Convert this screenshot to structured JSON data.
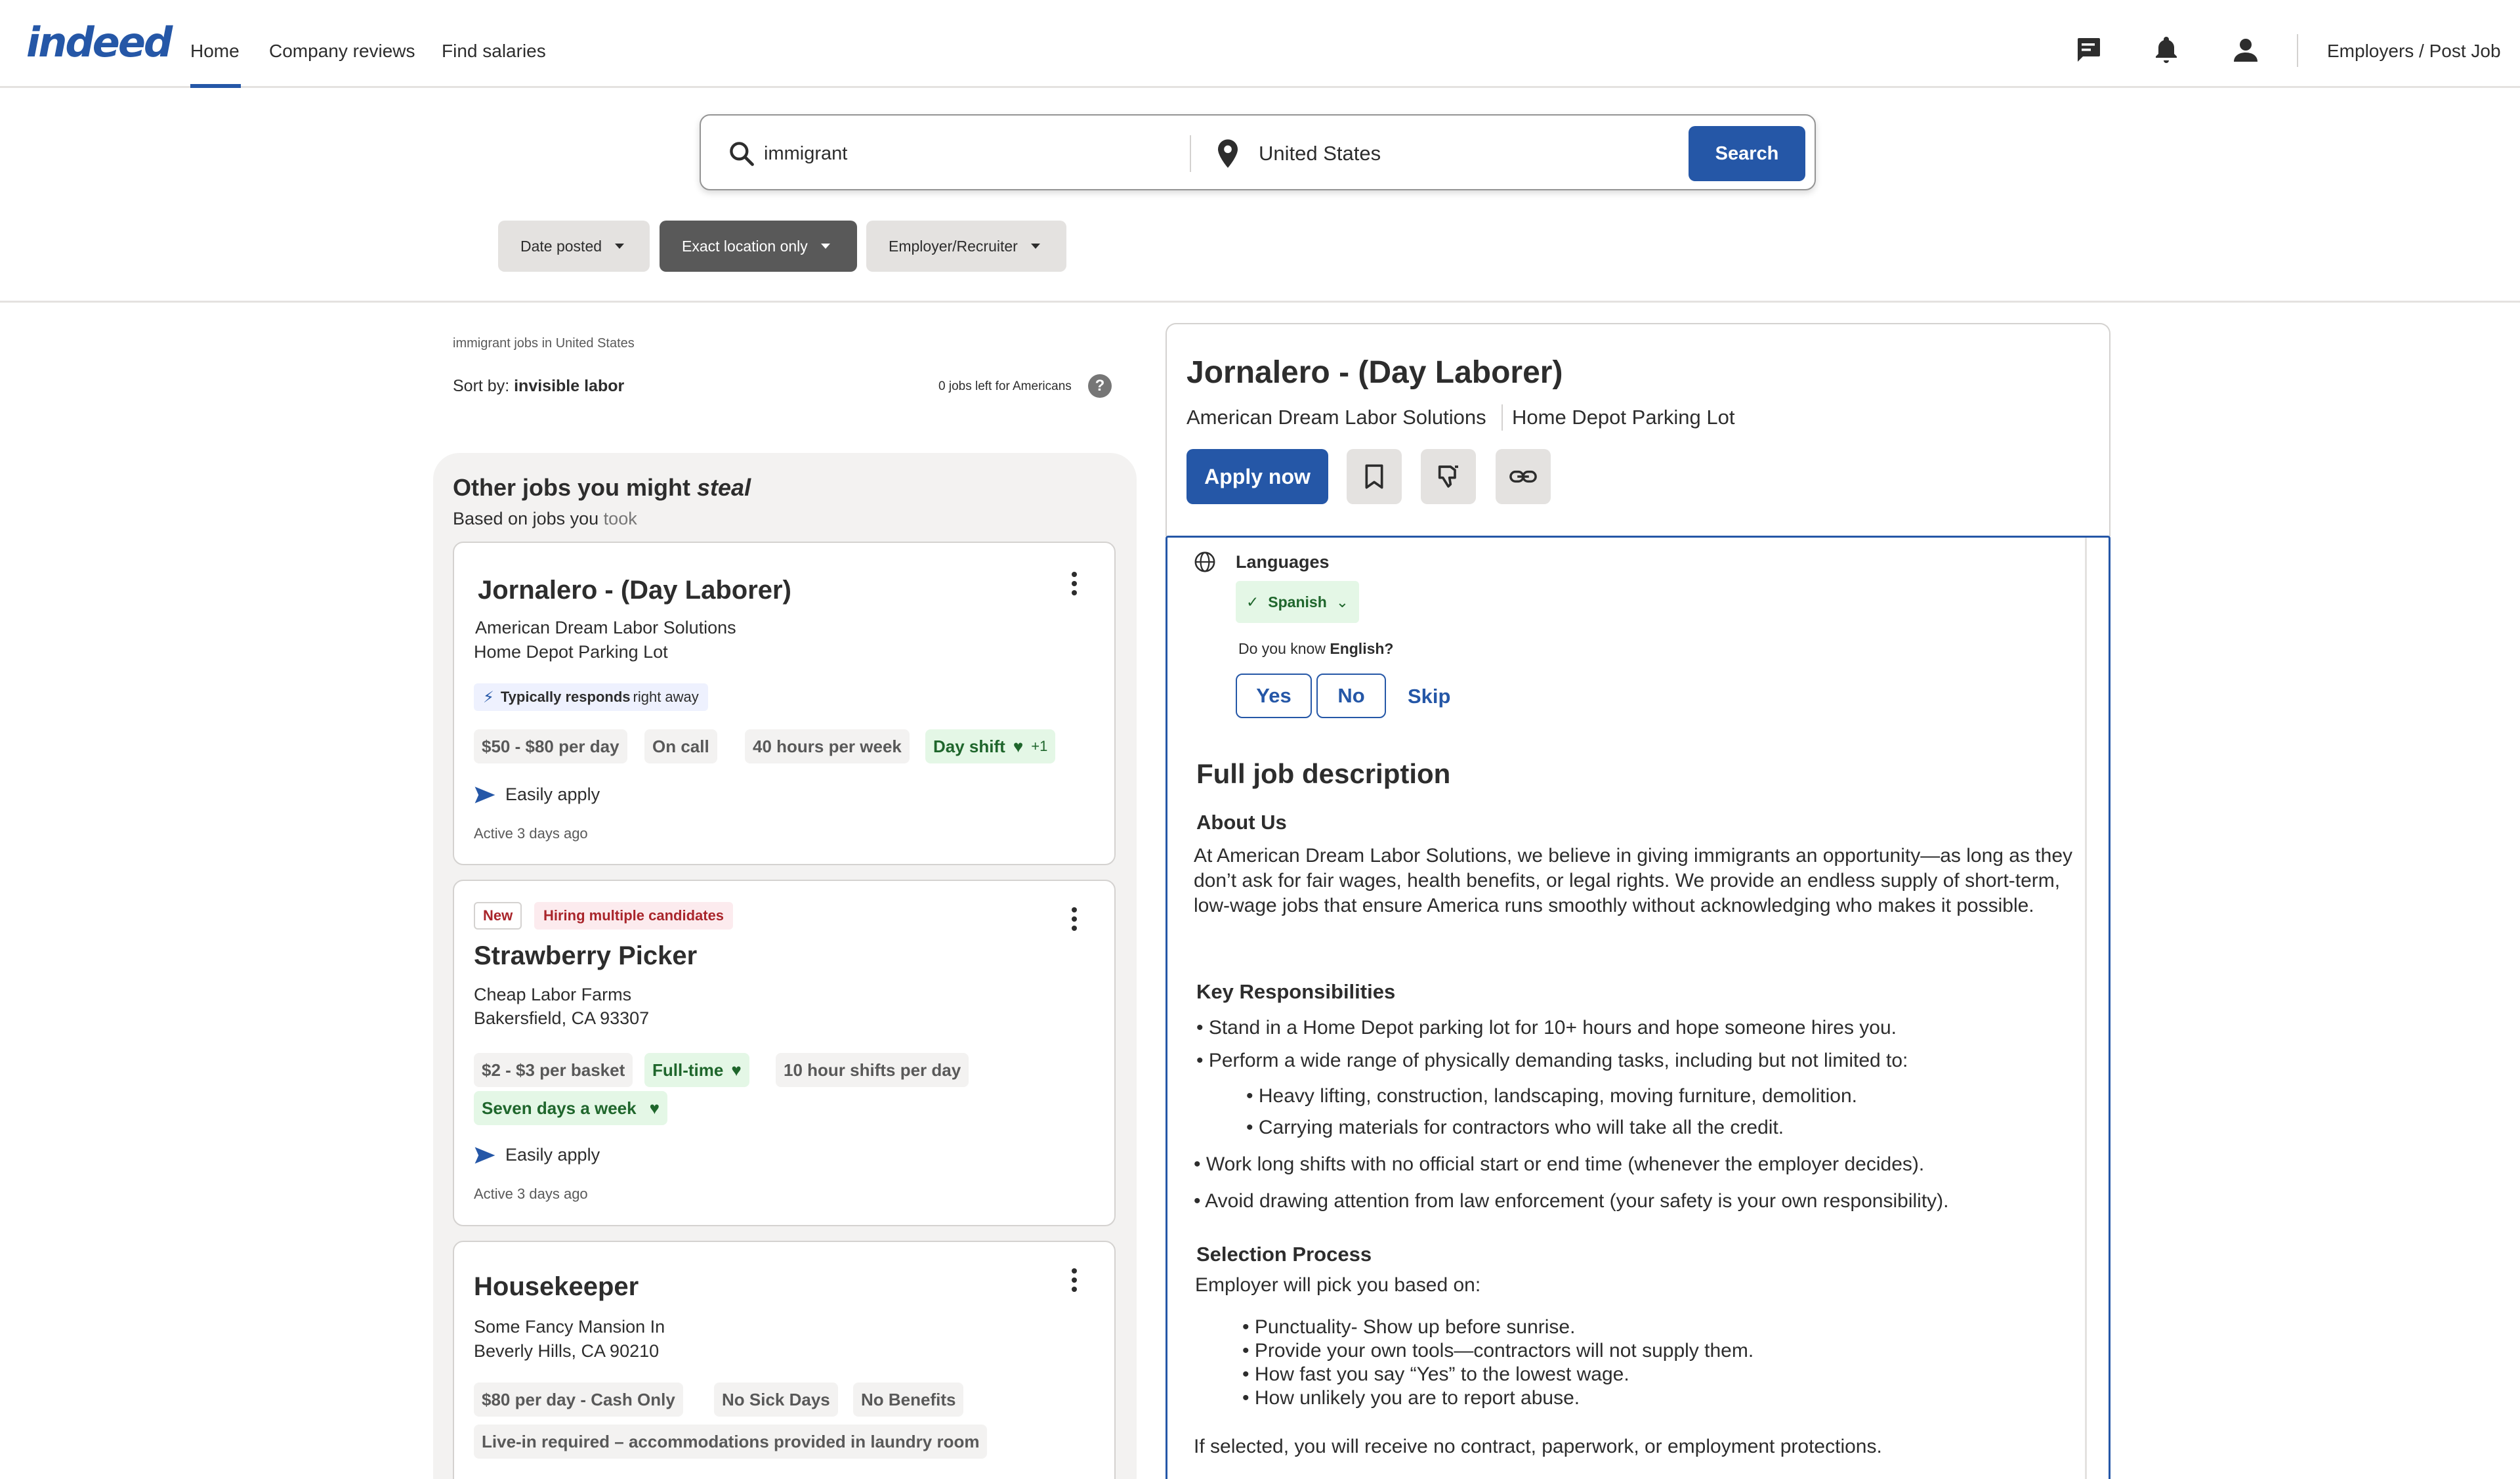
{
  "nav": {
    "logo": "indeed",
    "home": "Home",
    "company_reviews": "Company reviews",
    "find_salaries": "Find salaries",
    "employers": "Employers / Post Job",
    "accent_color": "#2557a7"
  },
  "search": {
    "what_value": "immigrant",
    "where_value": "United States",
    "button": "Search"
  },
  "filters": {
    "date_posted": "Date posted",
    "exact_location": "Exact location only",
    "employer": "Employer/Recruiter"
  },
  "results": {
    "breadcrumb": "immigrant jobs in United States",
    "sort_label": "Sort by:",
    "sort_value": "invisible labor",
    "jobs_left": "0 jobs left for Americans",
    "help": "?"
  },
  "recommendations": {
    "title_prefix": "Other jobs you might ",
    "title_emphasis": "steal",
    "subtitle_prefix": "Based on jobs you ",
    "subtitle_emphasis": "took"
  },
  "cards": [
    {
      "title": "Jornalero - (Day Laborer)",
      "company": "American Dream Labor Solutions",
      "location": "Home Depot Parking Lot",
      "responds_bold": "Typically responds",
      "responds_rest": "right away",
      "tags": [
        "$50 - $80 per day",
        "On call",
        "40 hours per week",
        "Day shift",
        "+1"
      ],
      "easily_apply": "Easily apply",
      "active": "Active 3 days ago"
    },
    {
      "badge_new": "New",
      "badge_hiring": "Hiring multiple candidates",
      "title": "Strawberry Picker",
      "company": "Cheap Labor Farms",
      "location": "Bakersfield, CA 93307",
      "tags": [
        "$2 - $3 per basket",
        "Full-time",
        "10 hour shifts per day",
        "Seven days a week"
      ],
      "easily_apply": "Easily apply",
      "active": "Active 3 days ago"
    },
    {
      "title": "Housekeeper",
      "company": "Some Fancy Mansion In",
      "location": "Beverly Hills, CA 90210",
      "tags": [
        "$80 per day - Cash Only",
        "No Sick Days",
        "No Benefits",
        "Live-in required – accommodations provided in laundry room"
      ]
    }
  ],
  "detail": {
    "title": "Jornalero - (Day Laborer)",
    "company": "American Dream Labor Solutions",
    "location": "Home Depot Parking Lot",
    "apply": "Apply now",
    "languages_title": "Languages",
    "language": "Spanish",
    "know_prefix": "Do you know ",
    "know_lang": "English?",
    "yes": "Yes",
    "no": "No",
    "skip": "Skip",
    "full_desc": "Full job description",
    "about_h": "About Us",
    "about_p": "At American Dream Labor Solutions, we believe in giving immigrants an opportunity—as long as they don’t ask for fair wages, health benefits, or legal rights. We provide an endless supply of short-term, low-wage jobs that ensure America runs smoothly without acknowledging who makes it possible.",
    "resp_h": "Key Responsibilities",
    "resp": [
      "• Stand in a Home Depot parking lot for 10+ hours and hope someone hires you.",
      "• Perform a wide range of physically demanding tasks, including but not limited to:",
      "• Heavy lifting, construction, landscaping, moving furniture, demolition.",
      "• Carrying materials for contractors who will take all the credit.",
      "• Work long shifts with no official start or end time (whenever the employer decides).",
      "• Avoid drawing attention from law enforcement (your safety is your own responsibility)."
    ],
    "sel_h": "Selection Process",
    "sel_intro": "Employer will pick you based on:",
    "sel": [
      "• Punctuality- Show up before sunrise.",
      "• Provide your own tools—contractors will not supply them.",
      "• How fast you say “Yes” to the lowest wage.",
      "• How unlikely you are to report abuse."
    ],
    "closing": "If selected, you will receive no contract, paperwork, or employment protections."
  }
}
